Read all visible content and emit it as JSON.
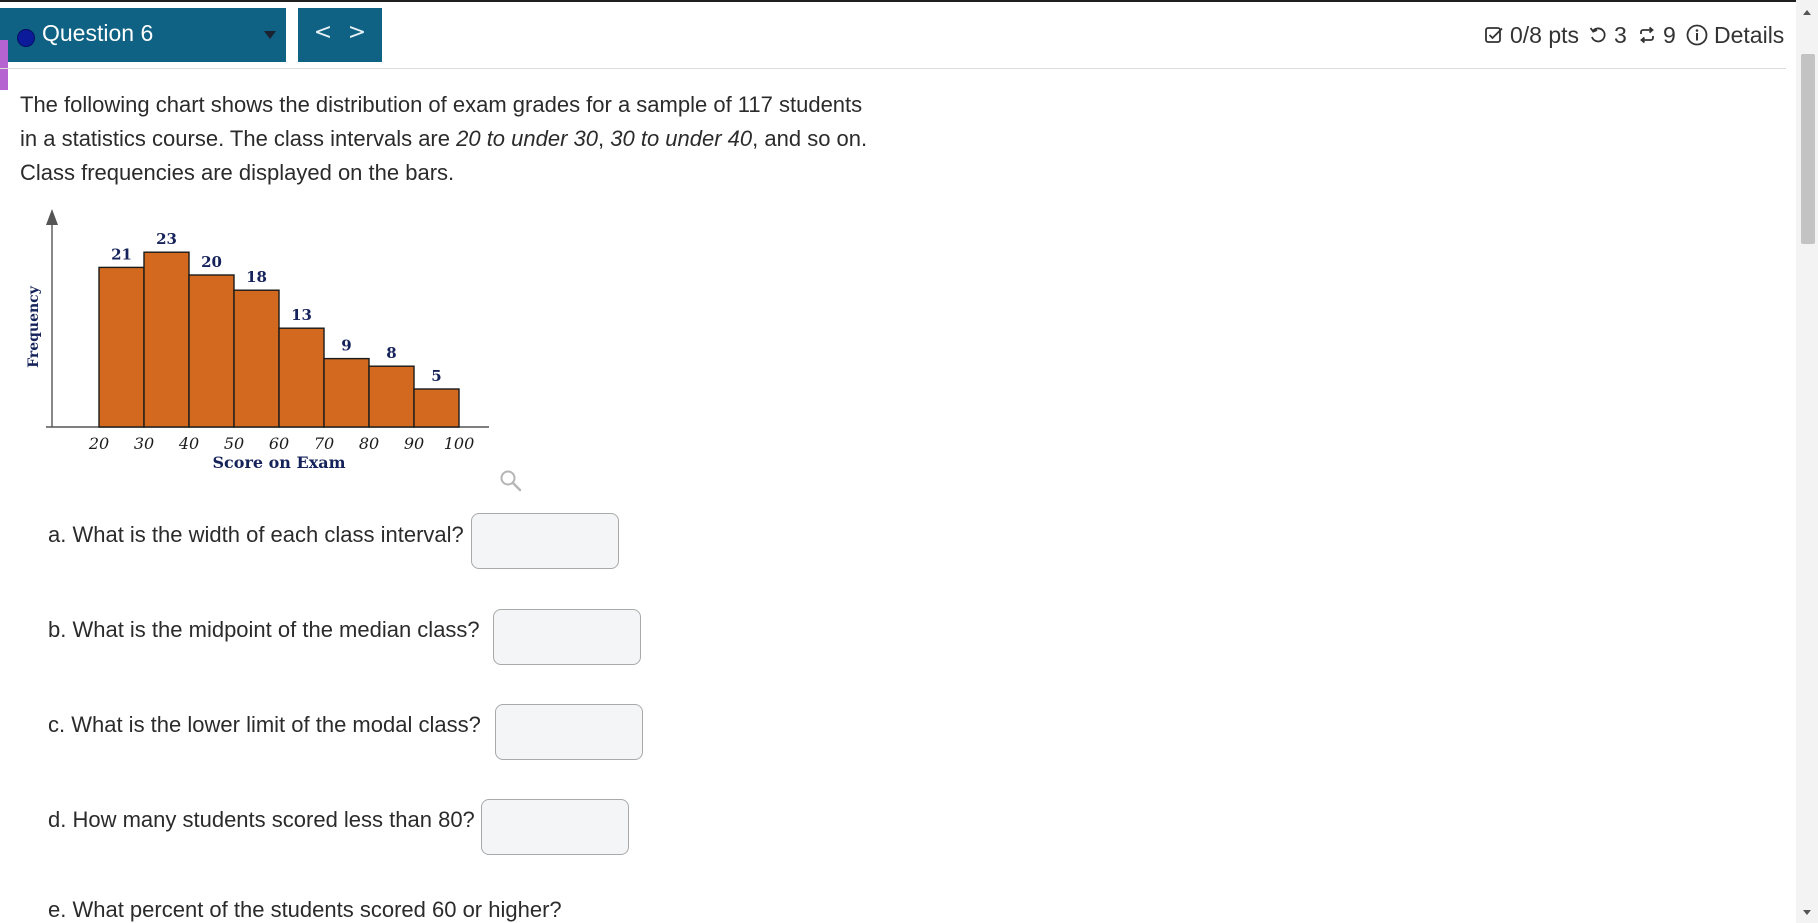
{
  "question": {
    "title": "Question 6",
    "prev_label": "<",
    "next_label": ">"
  },
  "meta": {
    "points": "0/8 pts",
    "retries": "3",
    "attempts": "9",
    "details": "Details"
  },
  "prompt": {
    "line1": "The following chart shows the distribution of exam grades for a sample of 117 students",
    "line2_pre": "in a statistics course. The class intervals are ",
    "line2_em1": "20 to under 30",
    "line2_sep": ", ",
    "line2_em2": "30 to under 40",
    "line2_post": ", and so on.",
    "line3": "Class frequencies are displayed on the bars."
  },
  "chart_data": {
    "type": "bar",
    "categories": [
      "20-30",
      "30-40",
      "40-50",
      "50-60",
      "60-70",
      "70-80",
      "80-90",
      "90-100"
    ],
    "values": [
      21,
      23,
      20,
      18,
      13,
      9,
      8,
      5
    ],
    "bin_edges": [
      20,
      30,
      40,
      50,
      60,
      70,
      80,
      90,
      100
    ],
    "xlabel": "Score on Exam",
    "ylabel": "Frequency",
    "bar_color": "#d2691e",
    "bar_edge_color": "#1a1a1a",
    "label_color": "#16235a"
  },
  "parts": [
    {
      "id": "a",
      "text": "a. What is the width of each class interval?",
      "value": ""
    },
    {
      "id": "b",
      "text": "b. What is the midpoint of the median class?",
      "value": ""
    },
    {
      "id": "c",
      "text": "c. What is the lower limit of the modal class?",
      "value": ""
    },
    {
      "id": "d",
      "text": "d. How many students scored less than 80?",
      "value": ""
    },
    {
      "id": "e",
      "text": "e. What percent of the students scored 60 or higher?"
    }
  ],
  "colors": {
    "header_bg": "#0f6284",
    "accent": "#b563d1"
  },
  "icons": {
    "points": "checkbox-icon",
    "retries": "retry-icon",
    "attempts": "repeat-icon",
    "details": "info-icon",
    "zoom": "magnifier-icon"
  }
}
